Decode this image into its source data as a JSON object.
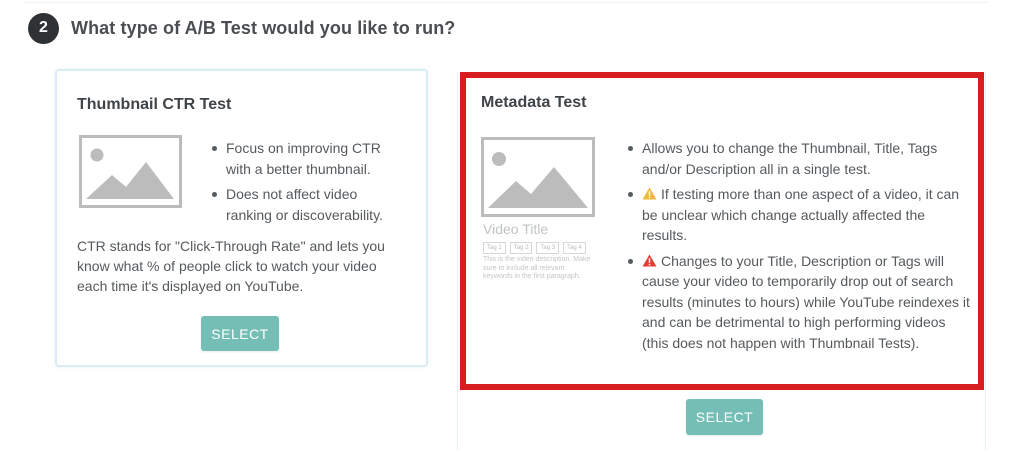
{
  "step": {
    "number": "2",
    "title": "What type of A/B Test would you like to run?"
  },
  "cards": {
    "thumbnail": {
      "title": "Thumbnail CTR Test",
      "bullets": [
        "Focus on improving CTR with a better thumbnail.",
        "Does not affect video ranking or discoverability."
      ],
      "description": "CTR stands for \"Click-Through Rate\" and lets you know what % of people click to watch your video each time it's displayed on YouTube.",
      "button_label": "SELECT",
      "image_icon": "image-placeholder-icon"
    },
    "metadata": {
      "title": "Metadata Test",
      "bullets": [
        "Allows you to change the Thumbnail, Title, Tags and/or Description all in a single test.",
        "If testing more than one aspect of a video, it can be unclear which change actually affected the results.",
        "Changes to your Title, Description or Tags will cause your video to temporarily drop out of search results (minutes to hours) while YouTube reindexes it and can be detrimental to high performing videos (this does not happen with Thumbnail Tests)."
      ],
      "preview": {
        "video_title": "Video Title",
        "tags": [
          "Tag 1",
          "Tag 2",
          "Tag 3",
          "Tag 4"
        ],
        "description": "This is the video description. Make sure to include all relevant keywords in the first paragraph."
      },
      "button_label": "SELECT",
      "image_icon": "image-placeholder-icon",
      "highlight_color": "#d71d1d"
    }
  },
  "colors": {
    "button": "#74beb6",
    "warning_yellow": "#f0b73a",
    "warning_red": "#e53c2e",
    "badge": "#2f3235"
  }
}
